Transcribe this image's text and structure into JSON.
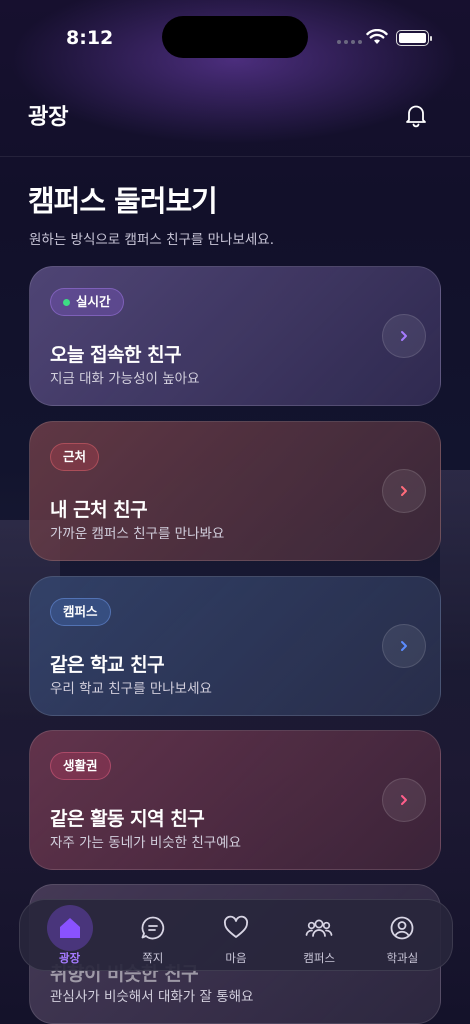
{
  "status_bar": {
    "time": "8:12"
  },
  "header": {
    "title": "광장"
  },
  "section": {
    "title": "캠퍼스 둘러보기",
    "subtitle": "원하는 방식으로 캠퍼스 친구를 만나보세요."
  },
  "cards": [
    {
      "badge": "실시간",
      "title": "오늘 접속한 친구",
      "subtitle": "지금 대화 가능성이 높아요",
      "accent": "#a57bff"
    },
    {
      "badge": "근처",
      "title": "내 근처 친구",
      "subtitle": "가까운 캠퍼스 친구를 만나봐요",
      "accent": "#ff6b7a"
    },
    {
      "badge": "캠퍼스",
      "title": "같은 학교 친구",
      "subtitle": "우리 학교 친구를 만나보세요",
      "accent": "#5b8cff"
    },
    {
      "badge": "생활권",
      "title": "같은 활동 지역 친구",
      "subtitle": "자주 가는 동네가 비슷한 친구예요",
      "accent": "#ff5e8a"
    },
    {
      "title": "취향이 비슷한 친구",
      "subtitle": "관심사가 비슷해서 대화가 잘 통해요"
    }
  ],
  "tabs": [
    {
      "label": "광장",
      "icon": "home-icon",
      "active": true
    },
    {
      "label": "쪽지",
      "icon": "chat-icon"
    },
    {
      "label": "마음",
      "icon": "heart-icon"
    },
    {
      "label": "캠퍼스",
      "icon": "people-icon"
    },
    {
      "label": "학과실",
      "icon": "profile-icon"
    }
  ],
  "colors": {
    "accent": "#a57bff",
    "live_dot": "#3ddc84"
  }
}
